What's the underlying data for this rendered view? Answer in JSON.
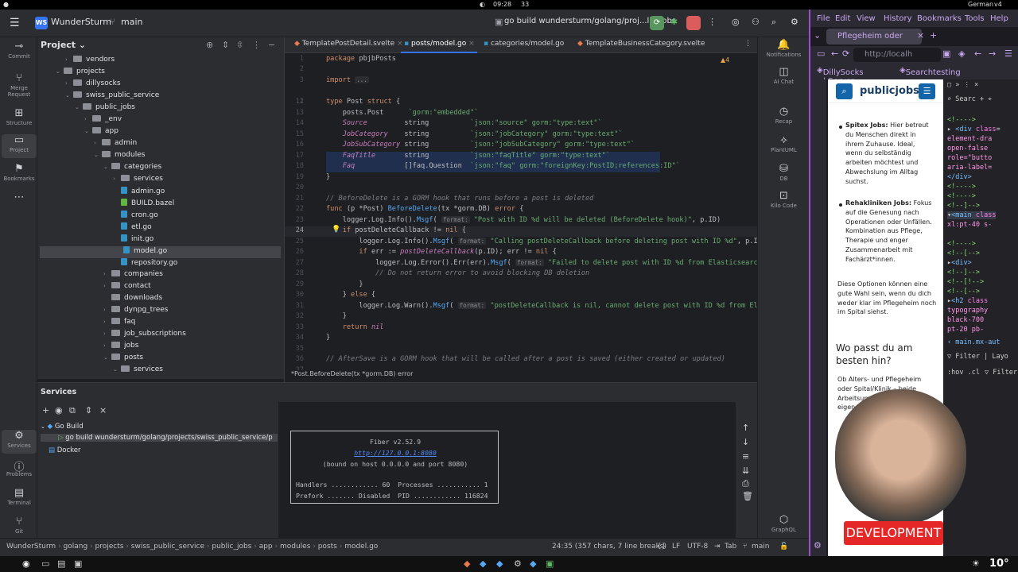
{
  "system_bar": {
    "time": "09:28",
    "updates": "33",
    "keyboard": "German",
    "version": "v4"
  },
  "ide": {
    "project_badge": "WS",
    "project_name": "WunderSturm",
    "branch": "main",
    "run_config": "go build wundersturm/golang/proj...lic_jobs"
  },
  "left_toolbar": {
    "commit": "Commit",
    "merge": "Merge Request",
    "structure": "Structure",
    "project": "Project",
    "bookmarks": "Bookmarks",
    "services": "Services",
    "problems": "Problems",
    "terminal": "Terminal",
    "git": "Git"
  },
  "project_panel": {
    "title": "Project",
    "tree": [
      {
        "label": "vendors",
        "type": "folder"
      },
      {
        "label": "projects",
        "type": "folder"
      },
      {
        "label": "dillysocks",
        "type": "folder"
      },
      {
        "label": "swiss_public_service",
        "type": "folder"
      },
      {
        "label": "public_jobs",
        "type": "folder"
      },
      {
        "label": "_env",
        "type": "folder"
      },
      {
        "label": "app",
        "type": "folder"
      },
      {
        "label": "admin",
        "type": "folder"
      },
      {
        "label": "modules",
        "type": "folder"
      },
      {
        "label": "categories",
        "type": "folder"
      },
      {
        "label": "services",
        "type": "folder"
      },
      {
        "label": "admin.go",
        "type": "go"
      },
      {
        "label": "BUILD.bazel",
        "type": "bazel"
      },
      {
        "label": "cron.go",
        "type": "go"
      },
      {
        "label": "etl.go",
        "type": "go"
      },
      {
        "label": "init.go",
        "type": "go"
      },
      {
        "label": "model.go",
        "type": "go"
      },
      {
        "label": "repository.go",
        "type": "go"
      },
      {
        "label": "companies",
        "type": "folder"
      },
      {
        "label": "contact",
        "type": "folder"
      },
      {
        "label": "downloads",
        "type": "folder"
      },
      {
        "label": "dynpg_trees",
        "type": "folder"
      },
      {
        "label": "faq",
        "type": "folder"
      },
      {
        "label": "job_subscriptions",
        "type": "folder"
      },
      {
        "label": "jobs",
        "type": "folder"
      },
      {
        "label": "posts",
        "type": "folder"
      },
      {
        "label": "services",
        "type": "folder"
      }
    ]
  },
  "editor": {
    "tabs": [
      {
        "label": "TemplatePostDetail.svelte"
      },
      {
        "label": "posts/model.go"
      },
      {
        "label": "categories/model.go"
      },
      {
        "label": "TemplateBusinessCategory.svelte"
      }
    ],
    "warnings": "4",
    "line_numbers": [
      "1",
      "2",
      "3",
      "11",
      "12",
      "13",
      "14",
      "15",
      "16",
      "17",
      "18",
      "19",
      "20",
      "21",
      "22",
      "23",
      "24",
      "25",
      "26",
      "27",
      "28",
      "29",
      "30",
      "31",
      "32",
      "33",
      "34",
      "35",
      "36",
      "37"
    ],
    "context_breadcrumb": "*Post.BeforeDelete(tx *gorm.DB) error"
  },
  "right_toolbar": {
    "notifications": "Notifications",
    "ai_chat": "AI Chat",
    "recap": "Recap",
    "plantuml": "PlantUML",
    "db": "DB",
    "kilo_code": "Kilo Code",
    "graphql": "GraphQL"
  },
  "services_panel": {
    "title": "Services",
    "go_build": "Go Build",
    "run_item": "go build wundersturm/golang/projects/swiss_public_service/p",
    "docker": "Docker",
    "console": {
      "line1": "Fiber v2.52.9",
      "line2": "http://127.0.0.1:8080",
      "line3": "(bound on host 0.0.0.0 and port 8080)",
      "line4": "Handlers ............ 60  Processes ........... 1",
      "line5": "Prefork ....... Disabled  PID ............ 116824"
    }
  },
  "status_bar": {
    "path": [
      "WunderSturm",
      "golang",
      "projects",
      "swiss_public_service",
      "public_jobs",
      "app",
      "modules",
      "posts",
      "model.go"
    ],
    "position": "24:35 (357 chars, 7 line breaks)",
    "line_sep": "LF",
    "encoding": "UTF-8",
    "indent": "Tab",
    "branch": "main"
  },
  "firefox": {
    "menu": [
      "File",
      "Edit",
      "View",
      "History",
      "Bookmarks",
      "Tools",
      "Help"
    ],
    "tab_title": "Pflegeheim oder",
    "url": "http://localh",
    "bookmarks": [
      "DillySocks | Server",
      "Searchtesting"
    ],
    "page": {
      "logo": "publicjobs",
      "spitex_title": "Spitex Jobs:",
      "spitex_text": "Hier betreut du Menschen direkt in ihrem Zuhause. Ideal, wenn du selbständig arbeiten möchtest und Abwechslung im Alltag suchst.",
      "reha_title": "Rehakliniken Jobs:",
      "reha_text": "Fokus auf die Genesung nach Operationen oder Unfällen. Kombination aus Pflege, Therapie und enger Zusammenarbeit mit Fachärzt*innen.",
      "para": "Diese Optionen können eine gute Wahl sein, wenn du dich weder klar im Pflegeheim noch im Spital siehst.",
      "heading": "Wo passt du am besten hin?",
      "para2": "Ob Alters- und Pflegeheim oder Spital/Klinik – beide Arbeitsumfelder haben ihre eigenen"
    },
    "devtools": {
      "filter": "Filter",
      "layout": "Layo",
      "filter_styles": "Filter Sty",
      "search": "Searc",
      "breadcrumb": "main.mx-aut",
      "hov": ":hov .cl"
    }
  },
  "overlay": {
    "banner": "DEVELOPMENT"
  },
  "weather": {
    "temp": "10°"
  }
}
